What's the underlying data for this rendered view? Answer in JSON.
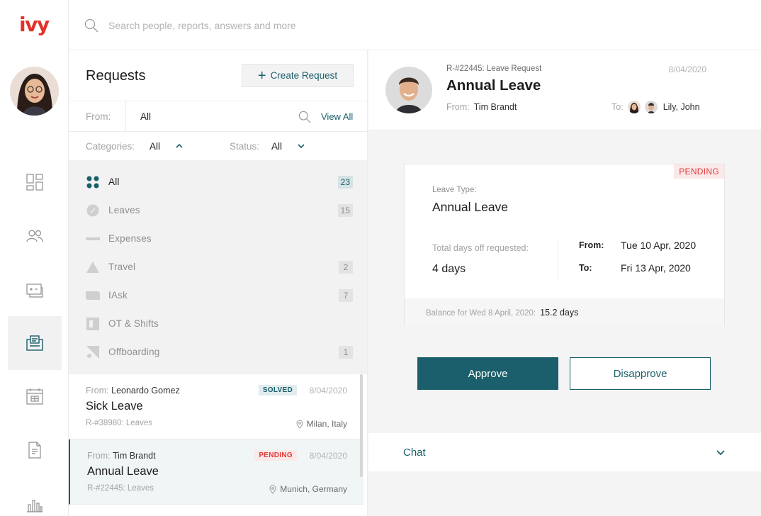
{
  "brand": {
    "logo": "ivy",
    "logo_color": "#e4312b",
    "accent": "#1a5f6b"
  },
  "search": {
    "placeholder": "Search people, reports, answers and more"
  },
  "nav": {
    "icons": [
      "dashboard-icon",
      "people-icon",
      "tickets-icon",
      "requests-icon",
      "calendar-icon",
      "document-icon",
      "analytics-icon"
    ],
    "active": "requests-icon"
  },
  "requests": {
    "title": "Requests",
    "create_label": "Create Request",
    "from_label": "From:",
    "from_value": "All",
    "view_all": "View All",
    "categories_label": "Categories:",
    "categories_value": "All",
    "status_label": "Status:",
    "status_value": "All",
    "categories": [
      {
        "label": "All",
        "count": "23",
        "icon": "grid-dots-icon"
      },
      {
        "label": "Leaves",
        "count": "15",
        "icon": "leaf-icon"
      },
      {
        "label": "Expenses",
        "count": "",
        "icon": "expense-icon"
      },
      {
        "label": "Travel",
        "count": "2",
        "icon": "travel-icon"
      },
      {
        "label": "IAsk",
        "count": "7",
        "icon": "iask-icon"
      },
      {
        "label": "OT & Shifts",
        "count": "",
        "icon": "shifts-icon"
      },
      {
        "label": "Offboarding",
        "count": "1",
        "icon": "offboarding-icon"
      }
    ],
    "items": [
      {
        "from_label": "From:",
        "from": "Leonardo Gomez",
        "title": "Sick Leave",
        "ref": "R-#38980:  Leaves",
        "status": "SOLVED",
        "date": "8/04/2020",
        "location": "Milan, Italy"
      },
      {
        "from_label": "From:",
        "from": "Tim Brandt",
        "title": "Annual Leave",
        "ref": "R-#22445:  Leaves",
        "status": "PENDING",
        "date": "8/04/2020",
        "location": "Munich, Germany"
      }
    ]
  },
  "detail": {
    "ref": "R-#22445:  Leave Request",
    "date": "8/04/2020",
    "title": "Annual Leave",
    "from_label": "From:",
    "from": "Tim Brandt",
    "to_label": "To:",
    "to": "Lily, John",
    "card": {
      "status": "PENDING",
      "leave_type_label": "Leave Type:",
      "leave_type": "Annual Leave",
      "total_label": "Total days off requested:",
      "total": "4 days",
      "from_key": "From:",
      "from_date": "Tue 10 Apr, 2020",
      "to_key": "To:",
      "to_date": "Fri 13 Apr, 2020",
      "balance_label": "Balance for Wed 8 April, 2020:",
      "balance": "15.2 days"
    },
    "approve_label": "Approve",
    "disapprove_label": "Disapprove",
    "chat_label": "Chat"
  }
}
